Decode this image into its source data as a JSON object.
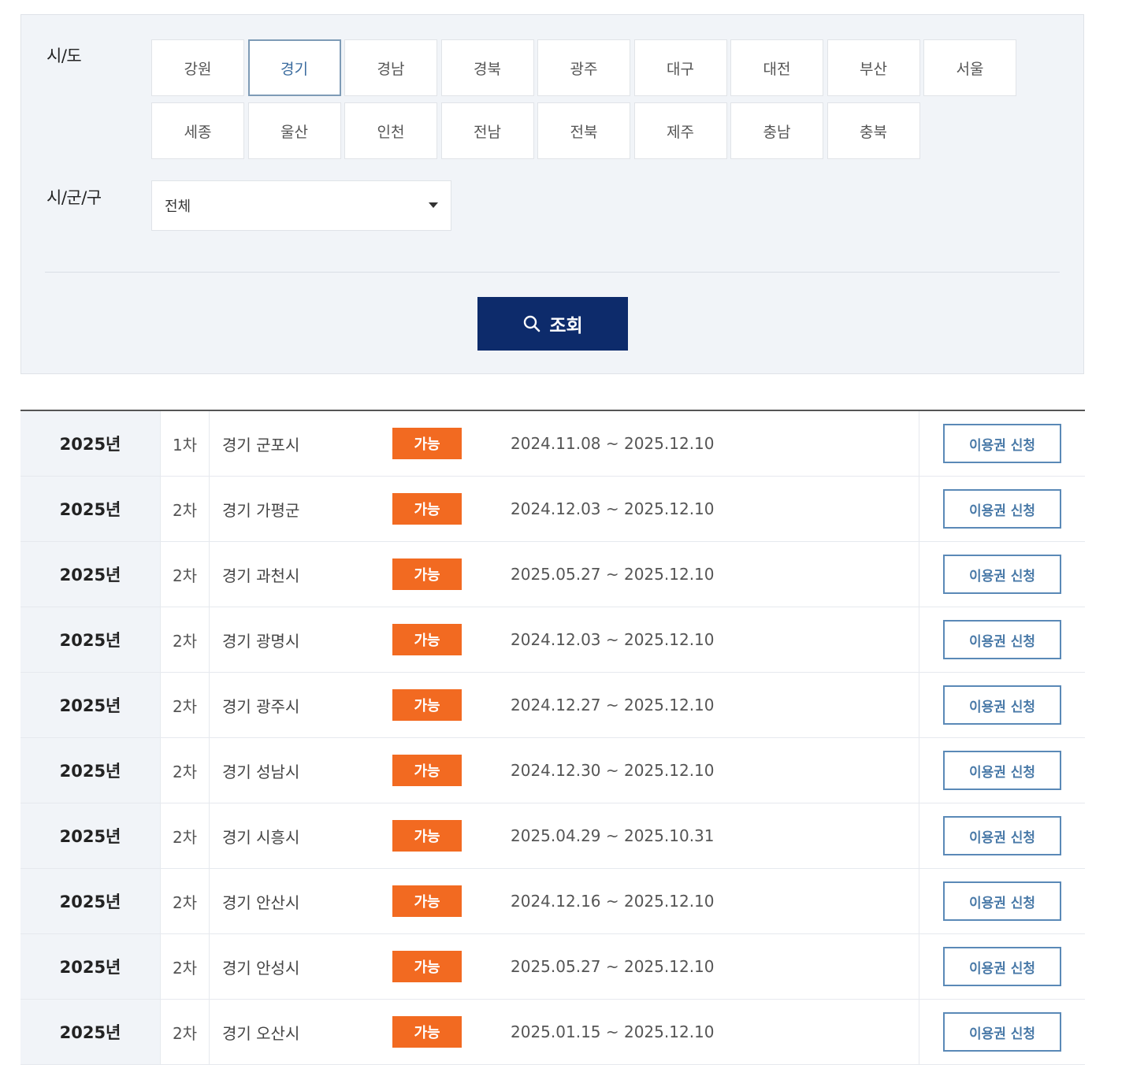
{
  "filter": {
    "sido_label": "시/도",
    "regions_row1": [
      "강원",
      "경기",
      "경남",
      "경북",
      "광주",
      "대구",
      "대전",
      "부산",
      "서울"
    ],
    "regions_row2": [
      "세종",
      "울산",
      "인천",
      "전남",
      "전북",
      "제주",
      "충남",
      "충북"
    ],
    "selected_region": "경기",
    "sigungu_label": "시/군/구",
    "sigungu_value": "전체",
    "search_label": "조회"
  },
  "table": {
    "rows": [
      {
        "year": "2025년",
        "round": "1차",
        "region": "경기 군포시",
        "status": "가능",
        "period": "2024.11.08 ~ 2025.12.10",
        "action": "이용권 신청"
      },
      {
        "year": "2025년",
        "round": "2차",
        "region": "경기 가평군",
        "status": "가능",
        "period": "2024.12.03 ~ 2025.12.10",
        "action": "이용권 신청"
      },
      {
        "year": "2025년",
        "round": "2차",
        "region": "경기 과천시",
        "status": "가능",
        "period": "2025.05.27 ~ 2025.12.10",
        "action": "이용권 신청"
      },
      {
        "year": "2025년",
        "round": "2차",
        "region": "경기 광명시",
        "status": "가능",
        "period": "2024.12.03 ~ 2025.12.10",
        "action": "이용권 신청"
      },
      {
        "year": "2025년",
        "round": "2차",
        "region": "경기 광주시",
        "status": "가능",
        "period": "2024.12.27 ~ 2025.12.10",
        "action": "이용권 신청"
      },
      {
        "year": "2025년",
        "round": "2차",
        "region": "경기 성남시",
        "status": "가능",
        "period": "2024.12.30 ~ 2025.12.10",
        "action": "이용권 신청"
      },
      {
        "year": "2025년",
        "round": "2차",
        "region": "경기 시흥시",
        "status": "가능",
        "period": "2025.04.29 ~ 2025.10.31",
        "action": "이용권 신청"
      },
      {
        "year": "2025년",
        "round": "2차",
        "region": "경기 안산시",
        "status": "가능",
        "period": "2024.12.16 ~ 2025.12.10",
        "action": "이용권 신청"
      },
      {
        "year": "2025년",
        "round": "2차",
        "region": "경기 안성시",
        "status": "가능",
        "period": "2025.05.27 ~ 2025.12.10",
        "action": "이용권 신청"
      },
      {
        "year": "2025년",
        "round": "2차",
        "region": "경기 오산시",
        "status": "가능",
        "period": "2025.01.15 ~ 2025.12.10",
        "action": "이용권 신청"
      }
    ]
  },
  "colors": {
    "primary_button": "#0d2b6b",
    "status_badge": "#f26a21",
    "apply_border": "#5a89b7",
    "panel_bg": "#f1f4f8"
  },
  "icons": {
    "search": "search-icon",
    "dropdown": "caret-down-icon"
  }
}
